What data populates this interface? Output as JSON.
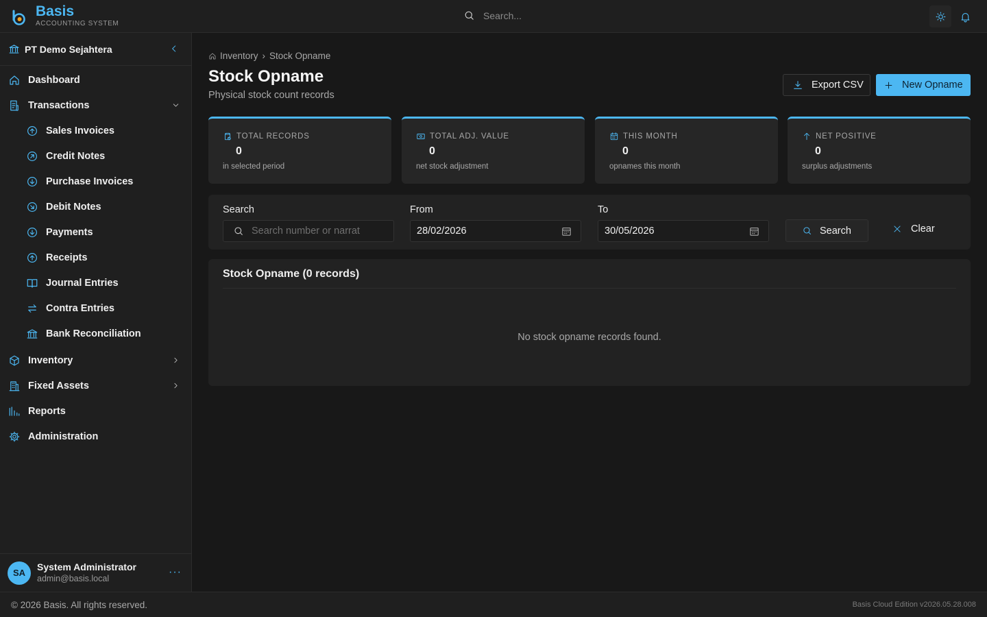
{
  "app": {
    "name": "Basis",
    "subtitle": "ACCOUNTING SYSTEM",
    "accent_color": "#4cb7f2"
  },
  "topbar": {
    "search_placeholder": "Search...",
    "icons": [
      "search-icon",
      "sun-icon",
      "bell-icon"
    ]
  },
  "sidebar": {
    "company": "PT Demo Sejahtera",
    "items": [
      {
        "label": "Dashboard",
        "icon": "home-icon"
      },
      {
        "label": "Transactions",
        "icon": "receipt-icon",
        "expanded": true
      },
      {
        "label": "Sales Invoices",
        "icon": "arrow-up-circle-icon"
      },
      {
        "label": "Credit Notes",
        "icon": "arrow-up-right-circle-icon"
      },
      {
        "label": "Purchase Invoices",
        "icon": "arrow-down-circle-icon"
      },
      {
        "label": "Debit Notes",
        "icon": "arrow-down-right-circle-icon"
      },
      {
        "label": "Payments",
        "icon": "arrow-down-circle-icon"
      },
      {
        "label": "Receipts",
        "icon": "arrow-up-circle-icon"
      },
      {
        "label": "Journal Entries",
        "icon": "book-icon"
      },
      {
        "label": "Contra Entries",
        "icon": "swap-icon"
      },
      {
        "label": "Bank Reconciliation",
        "icon": "bank-icon"
      },
      {
        "label": "Inventory",
        "icon": "box-icon"
      },
      {
        "label": "Fixed Assets",
        "icon": "building-icon"
      },
      {
        "label": "Reports",
        "icon": "bar-chart-icon"
      },
      {
        "label": "Administration",
        "icon": "gear-icon"
      }
    ],
    "user": {
      "initials": "SA",
      "name": "System Administrator",
      "email": "admin@basis.local",
      "more": "···"
    }
  },
  "breadcrumb": {
    "parent": "Inventory",
    "separator": "›",
    "current": "Stock Opname"
  },
  "page": {
    "title": "Stock Opname",
    "subtitle": "Physical stock count records",
    "export_label": "Export CSV",
    "new_label": "New Opname"
  },
  "stats": [
    {
      "label": "TOTAL RECORDS",
      "value": "0",
      "note": "in selected period",
      "icon": "clipboard-check-icon"
    },
    {
      "label": "TOTAL ADJ. VALUE",
      "value": "0",
      "note": "net stock adjustment",
      "icon": "money-icon"
    },
    {
      "label": "THIS MONTH",
      "value": "0",
      "note": "opnames this month",
      "icon": "calendar-icon"
    },
    {
      "label": "NET POSITIVE",
      "value": "0",
      "note": "surplus adjustments",
      "icon": "arrow-up-icon"
    }
  ],
  "filter": {
    "search_label": "Search",
    "search_placeholder": "Search number or narrat",
    "from_label": "From",
    "from_value": "28/02/2026",
    "to_label": "To",
    "to_value": "30/05/2026",
    "search_button": "Search",
    "clear_button": "Clear"
  },
  "table": {
    "title": "Stock Opname (0 records)",
    "empty_message": "No stock opname records found."
  },
  "footer": {
    "copyright": "© 2026 Basis. All rights reserved.",
    "version": "Basis Cloud Edition v2026.05.28.008"
  }
}
